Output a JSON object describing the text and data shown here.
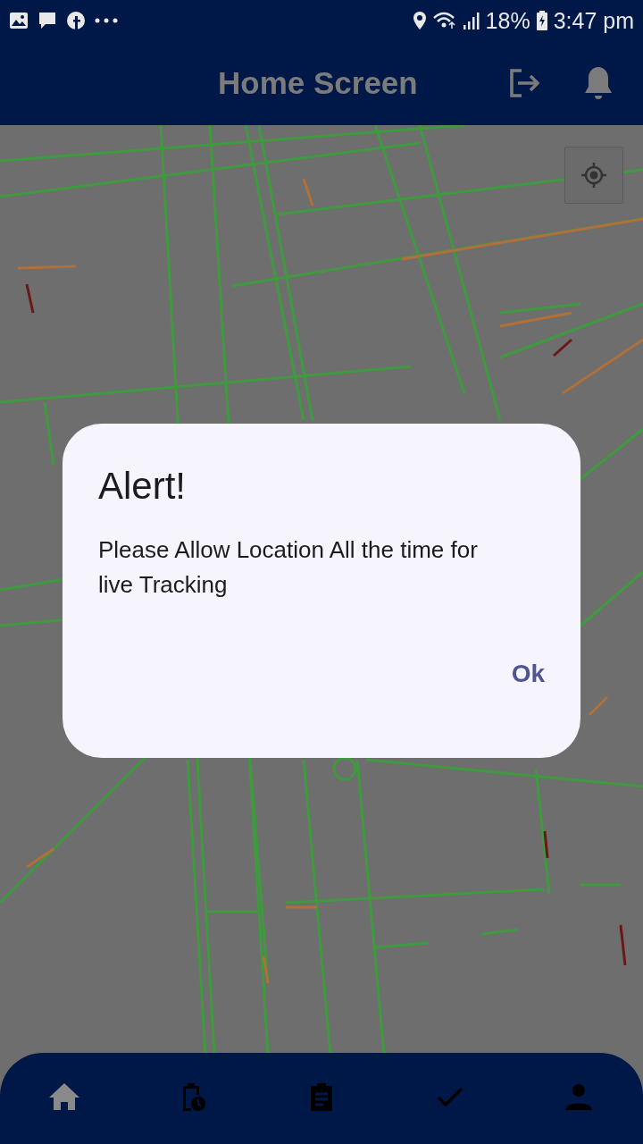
{
  "status_bar": {
    "battery": "18%",
    "time": "3:47 pm"
  },
  "header": {
    "title": "Home Screen"
  },
  "dialog": {
    "title": "Alert!",
    "message": "Please Allow Location All the time for live Tracking",
    "button": "Ok"
  },
  "bottom_nav": [
    {
      "kind": "home",
      "selected": true
    },
    {
      "kind": "schedule",
      "selected": false
    },
    {
      "kind": "clipboard",
      "selected": false
    },
    {
      "kind": "check",
      "selected": false
    },
    {
      "kind": "person",
      "selected": false
    }
  ]
}
